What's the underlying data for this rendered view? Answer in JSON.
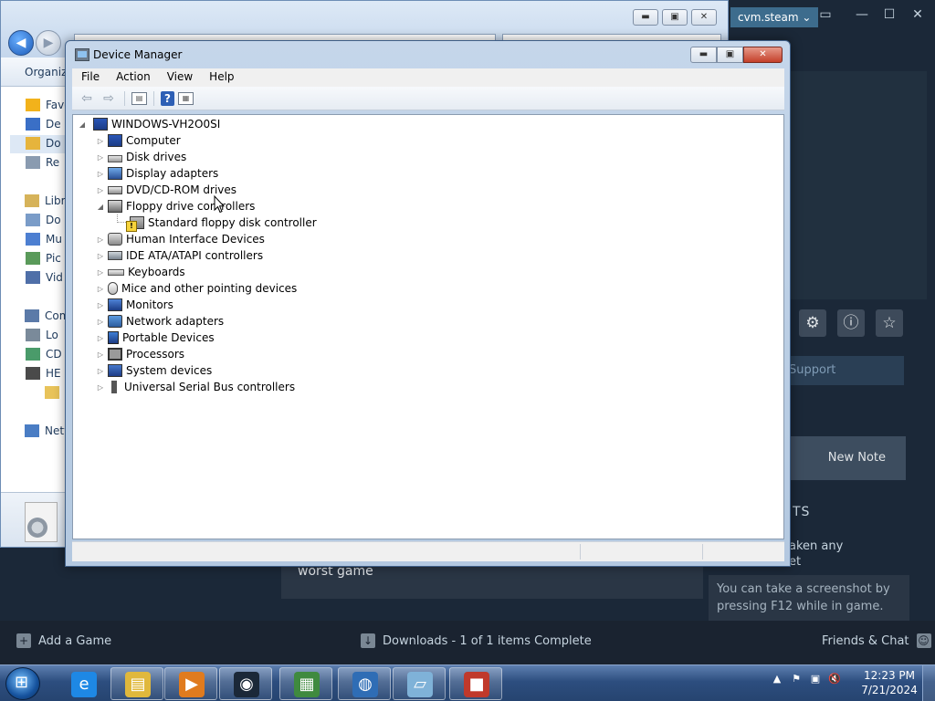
{
  "steam": {
    "username": "cvm.steam",
    "minimize_glyph": "—",
    "restore_glyph": "☐",
    "close_glyph": "✕",
    "monitor_glyph": "▭",
    "icons": {
      "settings": "⚙",
      "info": "ⓘ",
      "star": "☆"
    },
    "support": "Support",
    "new_note": "New Note",
    "heading_fragment": "TS",
    "text_fragment_1": "aken any",
    "text_fragment_2": "et",
    "comment": "worst game",
    "tip": "You can take a screenshot by pressing F12 while in game.",
    "add_game": "Add a Game",
    "downloads": "Downloads - 1 of 1 items Complete",
    "friends": "Friends & Chat"
  },
  "explorer": {
    "organize": "Organize",
    "sidebar": [
      {
        "label": "Favo",
        "icon": "star-icon"
      },
      {
        "label": "De",
        "icon": "desktop-icon"
      },
      {
        "label": "Do",
        "icon": "downloads-icon"
      },
      {
        "label": "Re",
        "icon": "recent-icon"
      },
      {
        "label": "Libra",
        "icon": "library-icon"
      },
      {
        "label": "Do",
        "icon": "documents-icon"
      },
      {
        "label": "Mu",
        "icon": "music-icon"
      },
      {
        "label": "Pic",
        "icon": "pictures-icon"
      },
      {
        "label": "Vid",
        "icon": "videos-icon"
      },
      {
        "label": "Com",
        "icon": "computer-icon"
      },
      {
        "label": "Lo",
        "icon": "local-disk-icon"
      },
      {
        "label": "CD",
        "icon": "cd-drive-icon"
      },
      {
        "label": "HE",
        "icon": "drive-icon"
      },
      {
        "label": "",
        "icon": "folder-icon"
      },
      {
        "label": "Netw",
        "icon": "network-icon"
      }
    ]
  },
  "device_manager": {
    "title": "Device Manager",
    "menu": [
      "File",
      "Action",
      "View",
      "Help"
    ],
    "root": "WINDOWS-VH2O0SI",
    "tree": [
      {
        "label": "Computer",
        "icon": "computer",
        "expanded": false
      },
      {
        "label": "Disk drives",
        "icon": "disk",
        "expanded": false
      },
      {
        "label": "Display adapters",
        "icon": "display",
        "expanded": false
      },
      {
        "label": "DVD/CD-ROM drives",
        "icon": "dvd",
        "expanded": false
      },
      {
        "label": "Floppy drive controllers",
        "icon": "floppy",
        "expanded": true,
        "children": [
          {
            "label": "Standard floppy disk controller",
            "icon": "std-floppy",
            "warning": true
          }
        ]
      },
      {
        "label": "Human Interface Devices",
        "icon": "hid",
        "expanded": false
      },
      {
        "label": "IDE ATA/ATAPI controllers",
        "icon": "ide",
        "expanded": false
      },
      {
        "label": "Keyboards",
        "icon": "keyboard",
        "expanded": false
      },
      {
        "label": "Mice and other pointing devices",
        "icon": "mouse",
        "expanded": false
      },
      {
        "label": "Monitors",
        "icon": "monitor",
        "expanded": false
      },
      {
        "label": "Network adapters",
        "icon": "network",
        "expanded": false
      },
      {
        "label": "Portable Devices",
        "icon": "portable",
        "expanded": false
      },
      {
        "label": "Processors",
        "icon": "processor",
        "expanded": false
      },
      {
        "label": "System devices",
        "icon": "system",
        "expanded": false
      },
      {
        "label": "Universal Serial Bus controllers",
        "icon": "usb",
        "expanded": false
      }
    ]
  },
  "taskbar": {
    "apps": [
      {
        "name": "internet-explorer",
        "glyph": "e",
        "color": "#1e88e5"
      },
      {
        "name": "file-explorer",
        "glyph": "▤",
        "color": "#e0b83c"
      },
      {
        "name": "media-player",
        "glyph": "▶",
        "color": "#e07b1e"
      },
      {
        "name": "steam",
        "glyph": "◉",
        "color": "#1b2838"
      },
      {
        "name": "system-monitor",
        "glyph": "▦",
        "color": "#3f8a3f"
      },
      {
        "name": "browser-globe",
        "glyph": "◍",
        "color": "#2f6db5"
      },
      {
        "name": "notepad",
        "glyph": "▱",
        "color": "#7fb2d8"
      },
      {
        "name": "toolbox",
        "glyph": "■",
        "color": "#c0392b"
      }
    ],
    "tray_icons": {
      "arrow": "▲",
      "flag": "⚑",
      "network": "▣",
      "volume": "🔇"
    },
    "time": "12:23 PM",
    "date": "7/21/2024"
  }
}
